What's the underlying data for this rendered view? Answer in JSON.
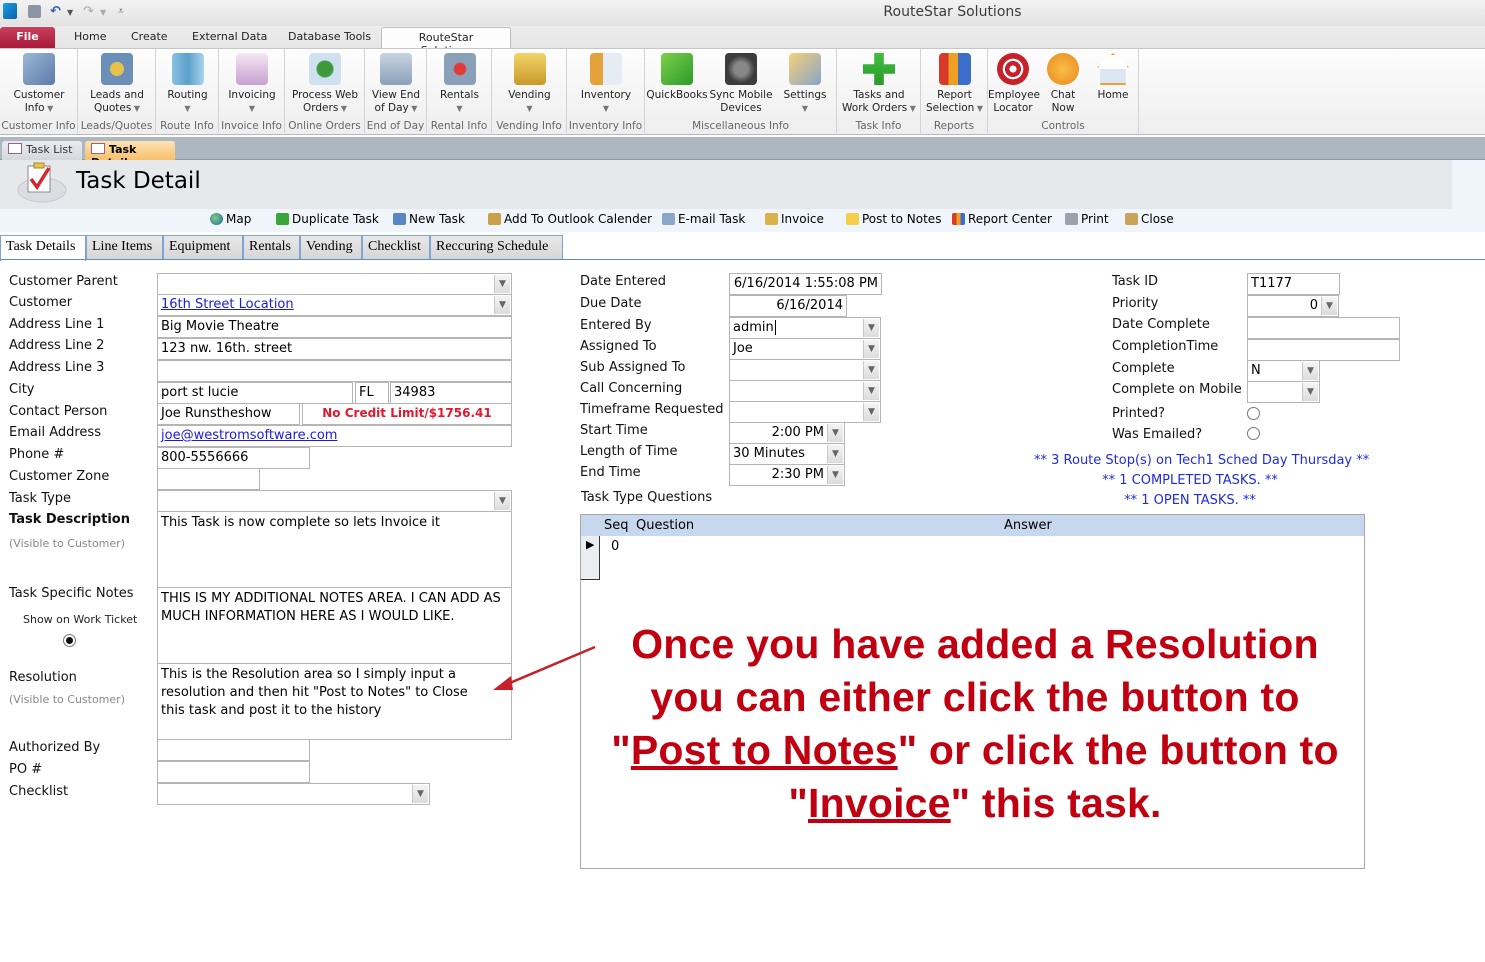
{
  "window": {
    "title": "RouteStar Solutions"
  },
  "ribbon_tabs": [
    "File",
    "Home",
    "Create",
    "External Data",
    "Database Tools",
    "RouteStar Solutions"
  ],
  "ribbon_groups": [
    {
      "label": "Customer Info",
      "buttons": [
        {
          "line1": "Customer",
          "line2": "Info",
          "dropdown": true,
          "icon": "customer-info-icon"
        }
      ]
    },
    {
      "label": "Leads/Quotes",
      "buttons": [
        {
          "line1": "Leads and",
          "line2": "Quotes",
          "dropdown": true,
          "icon": "leads-quotes-icon"
        }
      ]
    },
    {
      "label": "Route Info",
      "buttons": [
        {
          "line1": "Routing",
          "line2": "",
          "dropdown": true,
          "icon": "routing-map-icon"
        }
      ]
    },
    {
      "label": "Invoice Info",
      "buttons": [
        {
          "line1": "Invoicing",
          "line2": "",
          "dropdown": true,
          "icon": "invoicing-icon"
        }
      ]
    },
    {
      "label": "Online Orders",
      "buttons": [
        {
          "line1": "Process Web",
          "line2": "Orders",
          "dropdown": true,
          "icon": "web-orders-globe-icon"
        }
      ]
    },
    {
      "label": "End of Day",
      "buttons": [
        {
          "line1": "View End",
          "line2": "of Day",
          "dropdown": true,
          "icon": "end-of-day-cabinet-icon"
        }
      ]
    },
    {
      "label": "Rental Info",
      "buttons": [
        {
          "line1": "Rentals",
          "line2": "",
          "dropdown": true,
          "icon": "rentals-icon"
        }
      ]
    },
    {
      "label": "Vending Info",
      "buttons": [
        {
          "line1": "Vending",
          "line2": "",
          "dropdown": true,
          "icon": "vending-coins-icon"
        }
      ]
    },
    {
      "label": "Inventory Info",
      "buttons": [
        {
          "line1": "Inventory",
          "line2": "",
          "dropdown": true,
          "icon": "inventory-icon"
        }
      ]
    },
    {
      "label": "Miscellaneous Info",
      "buttons": [
        {
          "line1": "QuickBooks",
          "line2": "",
          "dropdown": false,
          "icon": "quickbooks-icon"
        },
        {
          "line1": "Sync Mobile",
          "line2": "Devices",
          "dropdown": false,
          "icon": "sync-gear-icon"
        },
        {
          "line1": "Settings",
          "line2": "",
          "dropdown": true,
          "icon": "settings-tools-icon"
        }
      ]
    },
    {
      "label": "Task Info",
      "buttons": [
        {
          "line1": "Tasks and",
          "line2": "Work Orders",
          "dropdown": true,
          "icon": "add-task-plus-icon"
        }
      ]
    },
    {
      "label": "Reports",
      "buttons": [
        {
          "line1": "Report",
          "line2": "Selection",
          "dropdown": true,
          "icon": "report-chart-icon"
        }
      ]
    },
    {
      "label": "Controls",
      "buttons": [
        {
          "line1": "Employee",
          "line2": "Locator",
          "dropdown": false,
          "icon": "target-locator-icon"
        },
        {
          "line1": "Chat",
          "line2": "Now",
          "dropdown": false,
          "icon": "chat-person-icon"
        },
        {
          "line1": "Home",
          "line2": "",
          "dropdown": false,
          "icon": "home-icon"
        }
      ]
    }
  ],
  "document_tabs": [
    {
      "label": "Task List",
      "active": false
    },
    {
      "label": "Task Detail",
      "active": true
    }
  ],
  "form": {
    "title": "Task Detail"
  },
  "toolbar": [
    {
      "label": "Map",
      "icon": "globe-icon"
    },
    {
      "label": "Duplicate Task",
      "icon": "duplicate-icon"
    },
    {
      "label": "New Task",
      "icon": "new-task-icon"
    },
    {
      "label": "Add To Outlook Calender",
      "icon": "outlook-add-icon"
    },
    {
      "label": "E-mail Task",
      "icon": "email-icon"
    },
    {
      "label": "Invoice",
      "icon": "invoice-icon"
    },
    {
      "label": "Post to Notes",
      "icon": "note-icon"
    },
    {
      "label": "Report Center",
      "icon": "bar-chart-icon"
    },
    {
      "label": "Print",
      "icon": "printer-icon"
    },
    {
      "label": "Close",
      "icon": "close-door-icon"
    }
  ],
  "form_tabs": [
    {
      "label": "Task Details",
      "active": true
    },
    {
      "label": "Line Items",
      "active": false
    },
    {
      "label": "Equipment",
      "active": false
    },
    {
      "label": "Rentals",
      "active": false
    },
    {
      "label": "Vending",
      "active": false
    },
    {
      "label": "Checklist",
      "active": false
    },
    {
      "label": "Reccuring Schedule",
      "active": false
    }
  ],
  "left": {
    "customer_parent": {
      "label": "Customer Parent",
      "value": ""
    },
    "customer": {
      "label": "Customer",
      "value": "16th Street Location"
    },
    "address1": {
      "label": "Address Line 1",
      "value": "Big Movie Theatre"
    },
    "address2": {
      "label": "Address Line 2",
      "value": "123 nw. 16th. street"
    },
    "address3": {
      "label": "Address Line 3",
      "value": ""
    },
    "city": {
      "label": "City",
      "value": "port st lucie",
      "state": "FL",
      "zip": "34983"
    },
    "contact": {
      "label": "Contact Person",
      "value": "Joe Runstheshow",
      "credit": "No Credit Limit/$1756.41"
    },
    "email": {
      "label": "Email Address",
      "value": "joe@westromsoftware.com"
    },
    "phone": {
      "label": "Phone #",
      "value": "800-5556666"
    },
    "zone": {
      "label": "Customer Zone",
      "value": ""
    },
    "task_type": {
      "label": "Task Type",
      "value": ""
    },
    "task_description": {
      "label": "Task Description",
      "sublabel": "(Visible to Customer)",
      "value": "This Task is now complete so lets Invoice it"
    },
    "task_notes": {
      "label": "Task Specific Notes",
      "sublabel": "Show on Work Ticket",
      "show_on_ticket": true,
      "value": "THIS IS MY ADDITIONAL NOTES AREA.  I CAN ADD AS MUCH INFORMATION HERE AS I WOULD LIKE."
    },
    "resolution": {
      "label": "Resolution",
      "sublabel": "(Visible to Customer)",
      "value": "This is the Resolution area so I simply input a resolution and then hit \"Post to Notes\" to Close this task and post it to the history"
    },
    "authorized_by": {
      "label": "Authorized By",
      "value": ""
    },
    "po": {
      "label": "PO #",
      "value": ""
    },
    "checklist": {
      "label": "Checklist",
      "value": ""
    }
  },
  "middle": {
    "date_entered": {
      "label": "Date Entered",
      "value": "6/16/2014 1:55:08 PM"
    },
    "due_date": {
      "label": "Due Date",
      "value": "6/16/2014"
    },
    "entered_by": {
      "label": "Entered By",
      "value": "admin"
    },
    "assigned_to": {
      "label": "Assigned To",
      "value": "Joe"
    },
    "sub_assigned_to": {
      "label": "Sub Assigned To",
      "value": ""
    },
    "call_concerning": {
      "label": "Call Concerning",
      "value": ""
    },
    "timeframe": {
      "label": "Timeframe Requested",
      "value": ""
    },
    "start_time": {
      "label": "Start Time",
      "value": "2:00 PM"
    },
    "length": {
      "label": "Length of Time",
      "value": "30 Minutes"
    },
    "end_time": {
      "label": "End Time",
      "value": "2:30 PM"
    },
    "questions_label": "Task Type Questions"
  },
  "right": {
    "task_id": {
      "label": "Task ID",
      "value": "T1177"
    },
    "priority": {
      "label": "Priority",
      "value": "0"
    },
    "date_complete": {
      "label": "Date Complete",
      "value": ""
    },
    "completion_time": {
      "label": "CompletionTime",
      "value": ""
    },
    "complete": {
      "label": "Complete",
      "value": "N"
    },
    "complete_mobile": {
      "label": "Complete on Mobile",
      "value": ""
    },
    "printed": {
      "label": "Printed?",
      "checked": false
    },
    "emailed": {
      "label": "Was Emailed?",
      "checked": false
    },
    "notices": [
      "** 3 Route Stop(s) on Tech1 Sched Day Thursday **",
      "** 1 COMPLETED TASKS. **",
      "** 1 OPEN TASKS. **"
    ]
  },
  "questions_table": {
    "columns": [
      "Seq",
      "Question",
      "Answer"
    ],
    "rows": [
      {
        "seq": "0",
        "question": "",
        "answer": ""
      }
    ]
  },
  "annotation": {
    "part1": "Once you have added a Resolution you can either click the button to \"",
    "link1": "Post to Notes",
    "part2": "\" or click the button to \"",
    "link2": "Invoice",
    "part3": "\" this task.",
    "color": "#c00010"
  }
}
